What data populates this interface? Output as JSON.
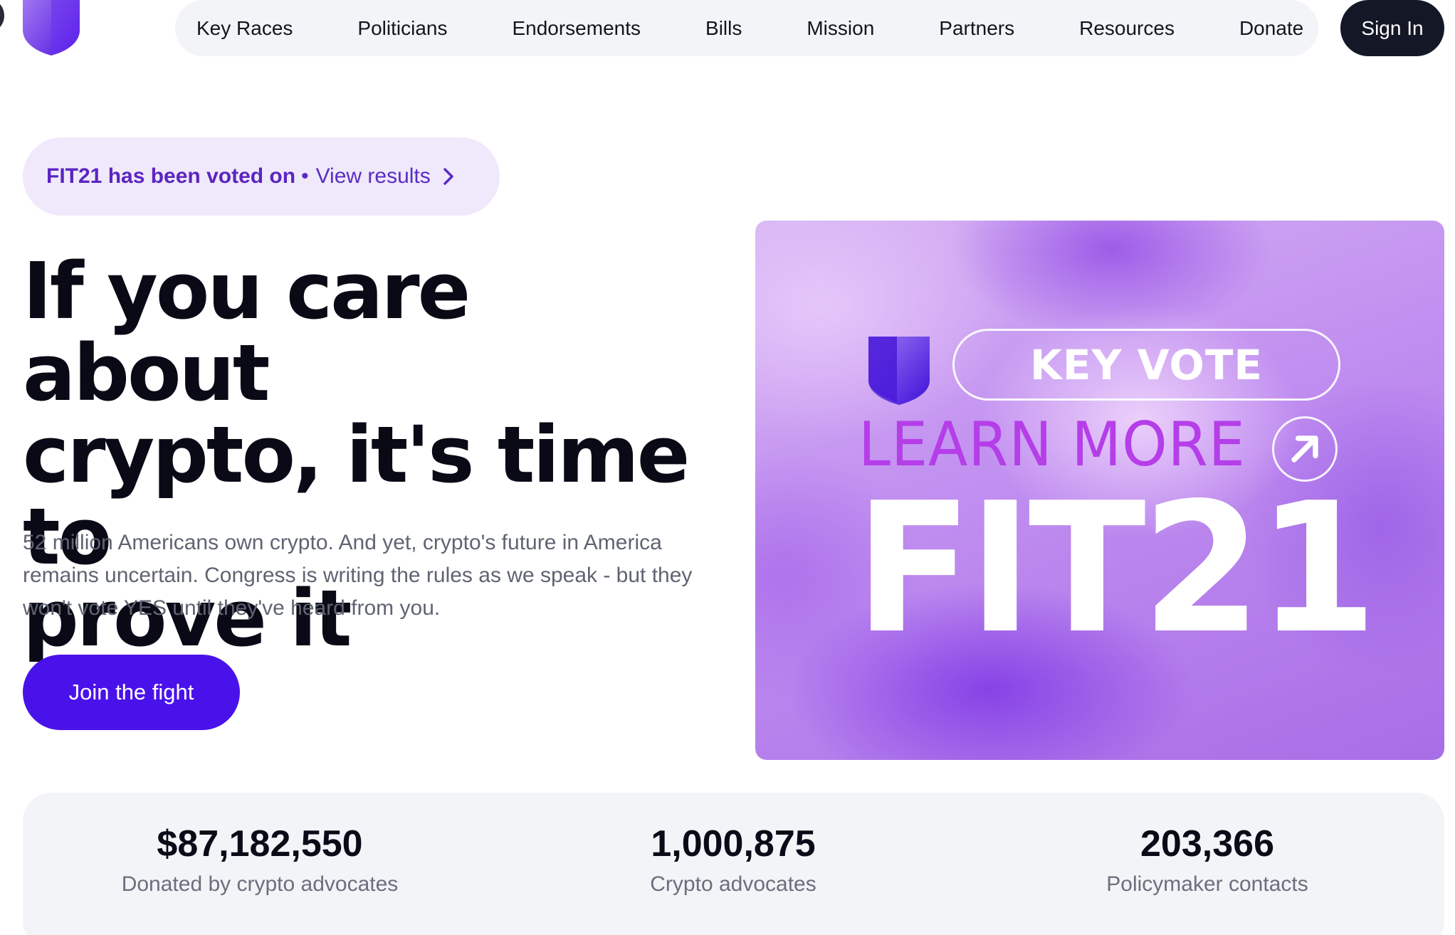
{
  "nav": {
    "items": [
      {
        "label": "Key Races"
      },
      {
        "label": "Politicians"
      },
      {
        "label": "Endorsements"
      },
      {
        "label": "Bills"
      },
      {
        "label": "Mission"
      },
      {
        "label": "Partners"
      },
      {
        "label": "Resources"
      },
      {
        "label": "Donate"
      }
    ],
    "signin_label": "Sign In"
  },
  "announcement": {
    "strong": "FIT21 has been voted on",
    "separator": "•",
    "link": "View results"
  },
  "hero": {
    "headline_lines": [
      "If you care about",
      "crypto, it's time to",
      "prove it"
    ],
    "subtext": "52 million Americans own crypto. And yet, crypto's future in America remains uncertain. Congress is writing the rules as we speak - but they won't vote YES until they've heard from you.",
    "cta_label": "Join the fight"
  },
  "banner": {
    "key_vote": "KEY VOTE",
    "learn_more": "LEARN MORE",
    "bill": "FIT21"
  },
  "stats": [
    {
      "value": "$87,182,550",
      "label": "Donated by crypto advocates"
    },
    {
      "value": "1,000,875",
      "label": "Crypto advocates"
    },
    {
      "value": "203,366",
      "label": "Policymaker contacts"
    }
  ],
  "colors": {
    "brand_purple": "#4a12ea",
    "pill_bg": "#efe9fb",
    "dark": "#141826",
    "stats_bg": "#f3f4f8"
  }
}
